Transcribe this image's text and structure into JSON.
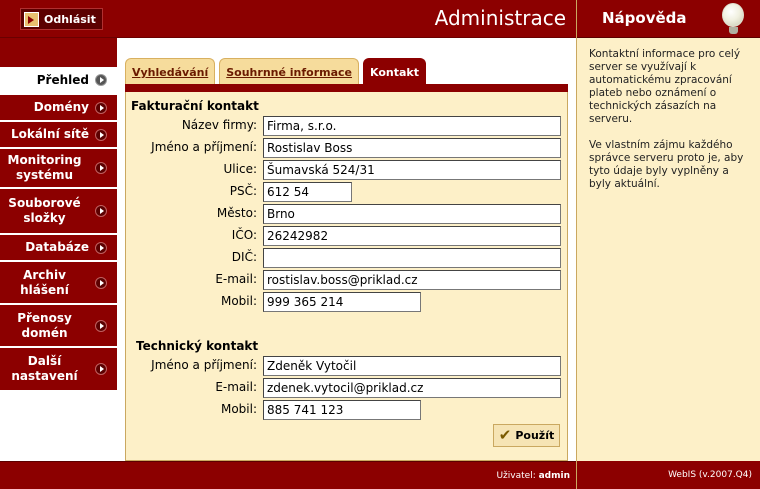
{
  "header": {
    "logout_label": "Odhlásit",
    "app_title": "Administrace"
  },
  "sidebar": {
    "items": [
      {
        "label": "Přehled",
        "active": true
      },
      {
        "label": "Domény"
      },
      {
        "label": "Lokální sítě"
      },
      {
        "label": "Monitoring systému"
      },
      {
        "label": "Souborové složky"
      },
      {
        "label": "Databáze"
      },
      {
        "label": "Archiv hlášení"
      },
      {
        "label": "Přenosy domén"
      },
      {
        "label": "Další nastavení"
      }
    ]
  },
  "tabs": [
    {
      "label": "Vyhledávání",
      "active": false
    },
    {
      "label": "Souhrnné informace",
      "active": false
    },
    {
      "label": "Kontakt",
      "active": true
    }
  ],
  "billing": {
    "title": "Fakturační kontakt",
    "company_label": "Název firmy:",
    "company": "Firma, s.r.o.",
    "name_label": "Jméno a příjmení:",
    "name": "Rostislav Boss",
    "street_label": "Ulice:",
    "street": "Šumavská 524/31",
    "zip_label": "PSČ:",
    "zip": "612 54",
    "city_label": "Město:",
    "city": "Brno",
    "ico_label": "IČO:",
    "ico": "26242982",
    "dic_label": "DIČ:",
    "dic": "",
    "email_label": "E-mail:",
    "email": "rostislav.boss@priklad.cz",
    "mobile_label": "Mobil:",
    "mobile": "999 365 214"
  },
  "technical": {
    "title": "Technický kontakt",
    "name_label": "Jméno a příjmení:",
    "name": "Zdeněk Vytočil",
    "email_label": "E-mail:",
    "email": "zdenek.vytocil@priklad.cz",
    "mobile_label": "Mobil:",
    "mobile": "885 741 123"
  },
  "apply_label": "Použít",
  "help": {
    "title": "Nápověda",
    "p1": "Kontaktní informace pro celý server se využívají k automatickému zpracování plateb nebo oznámení o technických zásazích na serveru.",
    "p2": "Ve vlastním zájmu každého správce serveru proto je, aby tyto údaje byly vyplněny a byly aktuální.",
    "version": "WebIS (v.2007.Q4)"
  },
  "footer": {
    "user_label": "Uživatel:",
    "user": "admin"
  },
  "colors": {
    "brand": "#8c0000",
    "panel": "#fdf0c8",
    "tab": "#f6dc9c"
  }
}
